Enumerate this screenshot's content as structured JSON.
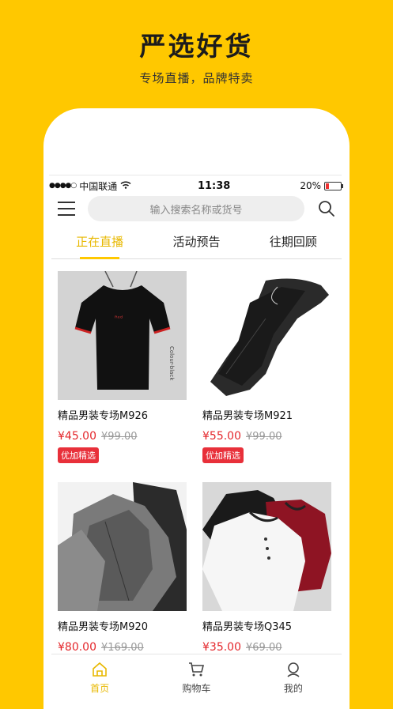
{
  "promo": {
    "title": "严选好货",
    "subtitle": "专场直播，品牌特卖"
  },
  "statusbar": {
    "carrier": "中国联通",
    "time": "11:38",
    "battery": "20%",
    "battery_level": 0.2
  },
  "search": {
    "placeholder": "输入搜索名称或货号"
  },
  "tabs": [
    {
      "label": "正在直播",
      "active": true
    },
    {
      "label": "活动预告",
      "active": false
    },
    {
      "label": "往期回顾",
      "active": false
    }
  ],
  "products": [
    {
      "name": "精品男装专场M926",
      "price": "¥45.00",
      "old_price": "¥99.00",
      "badge": "优加精选",
      "image": "black-tshirt"
    },
    {
      "name": "精品男装专场M921",
      "price": "¥55.00",
      "old_price": "¥99.00",
      "badge": "优加精选",
      "image": "black-pants"
    },
    {
      "name": "精品男装专场M920",
      "price": "¥80.00",
      "old_price": "¥169.00",
      "badge": "",
      "image": "gray-jackets"
    },
    {
      "name": "精品男装专场Q345",
      "price": "¥35.00",
      "old_price": "¥69.00",
      "badge": "",
      "image": "polo-shirts"
    }
  ],
  "bottom_nav": [
    {
      "label": "首页",
      "icon": "home-icon",
      "active": true
    },
    {
      "label": "购物车",
      "icon": "cart-icon",
      "active": false
    },
    {
      "label": "我的",
      "icon": "profile-icon",
      "active": false
    }
  ],
  "colors": {
    "accent": "#FFC800",
    "price": "#e4262b",
    "badge": "#e8303a"
  }
}
